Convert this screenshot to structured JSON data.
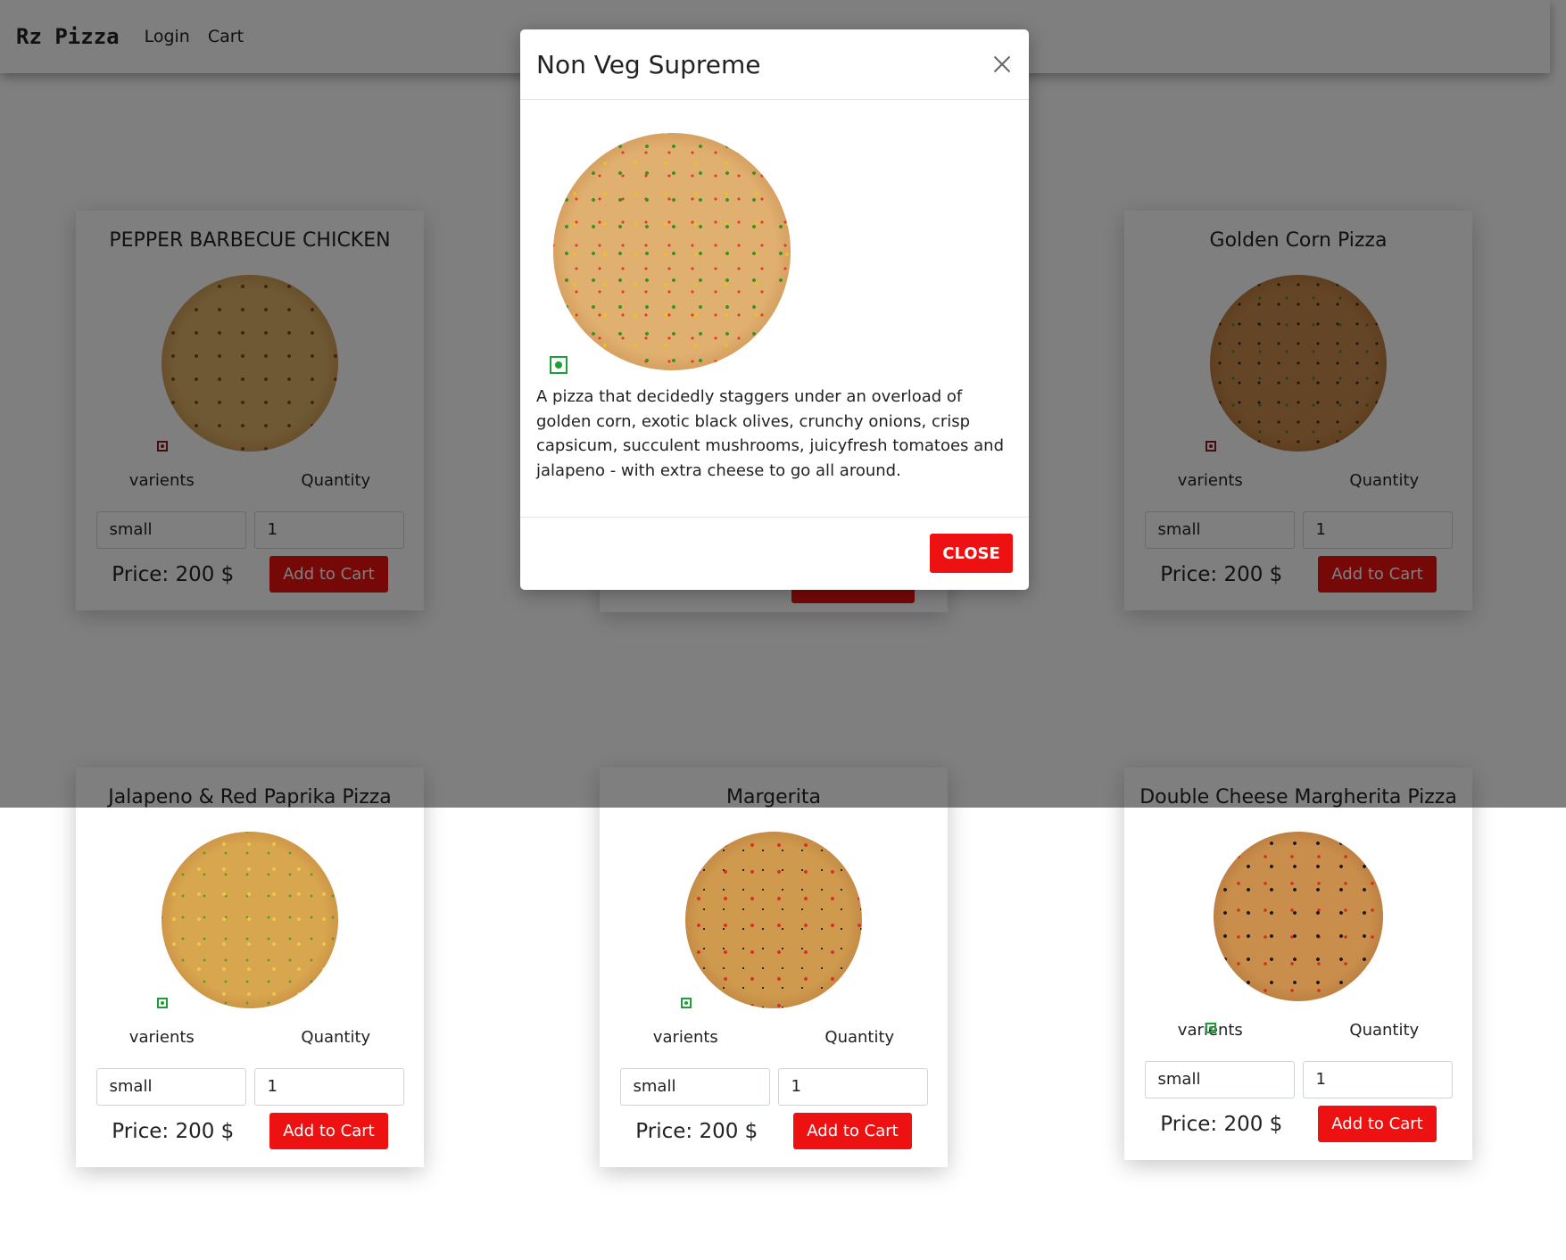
{
  "navbar": {
    "brand": "Rz Pizza",
    "login": "Login",
    "cart": "Cart"
  },
  "labels": {
    "variants": "varients",
    "quantity": "Quantity",
    "add_to_cart": "Add to Cart"
  },
  "pizzas": [
    {
      "name": "PEPPER BARBECUE CHICKEN",
      "veg": false,
      "variant": "small",
      "quantity": "1",
      "price": "Price: 200 $"
    },
    {
      "name": "Golden Corn Pizza",
      "veg": false,
      "variant": "small",
      "quantity": "1",
      "price": "Price: 200 $"
    },
    {
      "name": "Jalapeno & Red Paprika Pizza",
      "veg": true,
      "variant": "small",
      "quantity": "1",
      "price": "Price: 200 $"
    },
    {
      "name": "Margerita",
      "veg": true,
      "variant": "small",
      "quantity": "1",
      "price": "Price: 200 $"
    },
    {
      "name": "Double Cheese Margherita Pizza",
      "veg": true,
      "variant": "small",
      "quantity": "1",
      "price": "Price: 200 $"
    }
  ],
  "modal": {
    "title": "Non Veg Supreme",
    "veg": true,
    "description": "A pizza that decidedly staggers under an overload of golden corn, exotic black olives, crunchy onions, crisp capsicum, succulent mushrooms, juicyfresh tomatoes and jalapeno - with extra cheese to go all around.",
    "close_label": "CLOSE"
  },
  "colors": {
    "accent": "#ee1111",
    "veg": "#1e9e3a",
    "nonveg": "#8b1a1a"
  }
}
